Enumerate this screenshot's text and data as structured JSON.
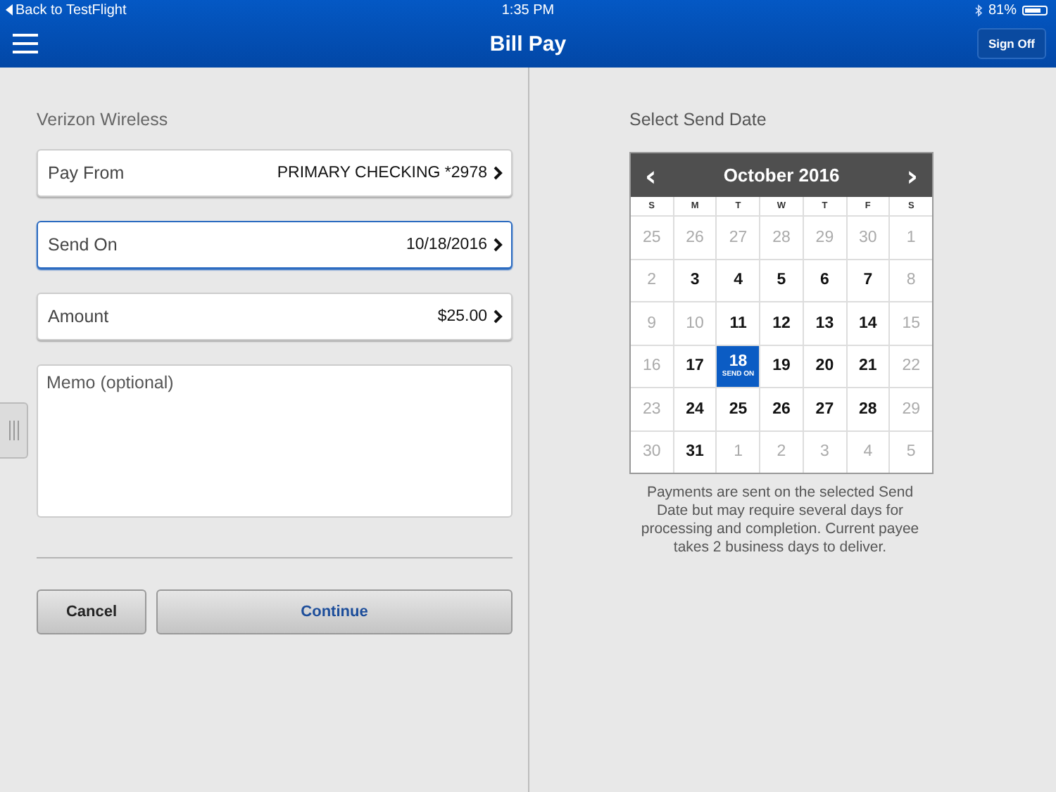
{
  "status_bar": {
    "back": "Back to TestFlight",
    "time": "1:35 PM",
    "battery": "81%"
  },
  "nav": {
    "title": "Bill Pay",
    "action": "Sign Off"
  },
  "form": {
    "payee": "Verizon Wireless",
    "fields": [
      {
        "label": "Pay From",
        "value": "PRIMARY CHECKING *2978",
        "focused": false
      },
      {
        "label": "Send On",
        "value": "10/18/2016",
        "focused": true
      },
      {
        "label": "Amount",
        "value": "$25.00",
        "focused": false
      }
    ],
    "memo": {
      "placeholder": "Memo (optional)"
    },
    "buttons": [
      {
        "label": "Cancel",
        "kind": "secondary"
      },
      {
        "label": "Continue",
        "kind": "primary"
      }
    ]
  },
  "calendar": {
    "heading": "Select Send Date",
    "month": "October 2016",
    "prev": "‹",
    "next": "›",
    "weekdays": [
      "S",
      "M",
      "T",
      "W",
      "T",
      "F",
      "S"
    ],
    "weeks": [
      [
        {
          "day": "25",
          "disabled": true,
          "selected": false
        },
        {
          "day": "26",
          "disabled": true,
          "selected": false
        },
        {
          "day": "27",
          "disabled": true,
          "selected": false
        },
        {
          "day": "28",
          "disabled": true,
          "selected": false
        },
        {
          "day": "29",
          "disabled": true,
          "selected": false
        },
        {
          "day": "30",
          "disabled": true,
          "selected": false
        },
        {
          "day": "1",
          "disabled": true,
          "selected": false
        }
      ],
      [
        {
          "day": "2",
          "disabled": true,
          "selected": false
        },
        {
          "day": "3",
          "disabled": false,
          "selected": false
        },
        {
          "day": "4",
          "disabled": false,
          "selected": false
        },
        {
          "day": "5",
          "disabled": false,
          "selected": false
        },
        {
          "day": "6",
          "disabled": false,
          "selected": false
        },
        {
          "day": "7",
          "disabled": false,
          "selected": false
        },
        {
          "day": "8",
          "disabled": true,
          "selected": false
        }
      ],
      [
        {
          "day": "9",
          "disabled": true,
          "selected": false
        },
        {
          "day": "10",
          "disabled": true,
          "selected": false
        },
        {
          "day": "11",
          "disabled": false,
          "selected": false
        },
        {
          "day": "12",
          "disabled": false,
          "selected": false
        },
        {
          "day": "13",
          "disabled": false,
          "selected": false
        },
        {
          "day": "14",
          "disabled": false,
          "selected": false
        },
        {
          "day": "15",
          "disabled": true,
          "selected": false
        }
      ],
      [
        {
          "day": "16",
          "disabled": true,
          "selected": false
        },
        {
          "day": "17",
          "disabled": false,
          "selected": false
        },
        {
          "day": "18",
          "disabled": false,
          "selected": true,
          "note": "SEND ON"
        },
        {
          "day": "19",
          "disabled": false,
          "selected": false
        },
        {
          "day": "20",
          "disabled": false,
          "selected": false
        },
        {
          "day": "21",
          "disabled": false,
          "selected": false
        },
        {
          "day": "22",
          "disabled": true,
          "selected": false
        }
      ],
      [
        {
          "day": "23",
          "disabled": true,
          "selected": false
        },
        {
          "day": "24",
          "disabled": false,
          "selected": false
        },
        {
          "day": "25",
          "disabled": false,
          "selected": false
        },
        {
          "day": "26",
          "disabled": false,
          "selected": false
        },
        {
          "day": "27",
          "disabled": false,
          "selected": false
        },
        {
          "day": "28",
          "disabled": false,
          "selected": false
        },
        {
          "day": "29",
          "disabled": true,
          "selected": false
        }
      ],
      [
        {
          "day": "30",
          "disabled": true,
          "selected": false
        },
        {
          "day": "31",
          "disabled": false,
          "selected": false
        },
        {
          "day": "1",
          "disabled": true,
          "selected": false
        },
        {
          "day": "2",
          "disabled": true,
          "selected": false
        },
        {
          "day": "3",
          "disabled": true,
          "selected": false
        },
        {
          "day": "4",
          "disabled": true,
          "selected": false
        },
        {
          "day": "5",
          "disabled": true,
          "selected": false
        }
      ]
    ],
    "note": "Payments are sent on the selected Send Date but may require several days for processing and completion. Current payee takes 2 business days to deliver."
  }
}
